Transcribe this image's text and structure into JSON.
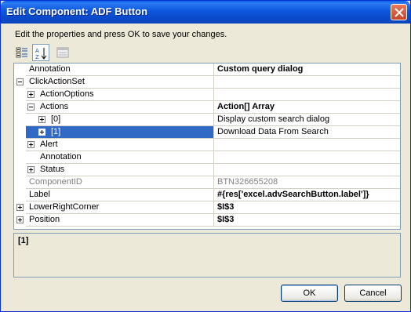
{
  "window": {
    "title": "Edit Component: ADF Button"
  },
  "instruction": "Edit the properties and press OK to save your changes.",
  "toolbar": {
    "buttons": [
      {
        "name": "categorized-view-icon",
        "active": false
      },
      {
        "name": "alphabetical-sort-icon",
        "active": true
      },
      {
        "name": "property-pages-icon",
        "active": false
      }
    ]
  },
  "grid": {
    "rows": [
      {
        "name": "Annotation",
        "value": "Custom query dialog",
        "value_bold": true,
        "indent": 0,
        "expander": "none"
      },
      {
        "name": "ClickActionSet",
        "value": "",
        "indent": 0,
        "expander": "minus"
      },
      {
        "name": "ActionOptions",
        "value": "",
        "indent": 1,
        "expander": "plus"
      },
      {
        "name": "Actions",
        "value": "Action[] Array",
        "value_bold": true,
        "indent": 1,
        "expander": "minus"
      },
      {
        "name": "[0]",
        "value": "Display custom search dialog",
        "indent": 2,
        "expander": "plus"
      },
      {
        "name": "[1]",
        "value": "Download Data From Search",
        "indent": 2,
        "expander": "plus",
        "selected": true
      },
      {
        "name": "Alert",
        "value": "",
        "indent": 1,
        "expander": "plus"
      },
      {
        "name": "Annotation",
        "value": "",
        "indent": 1,
        "expander": "none"
      },
      {
        "name": "Status",
        "value": "",
        "indent": 1,
        "expander": "plus"
      },
      {
        "name": "ComponentID",
        "value": "BTN326655208",
        "indent": 0,
        "expander": "none",
        "gray": true
      },
      {
        "name": "Label",
        "value": "#{res['excel.advSearchButton.label']}",
        "value_bold": true,
        "indent": 0,
        "expander": "none"
      },
      {
        "name": "LowerRightCorner",
        "value": "$I$3",
        "value_bold": true,
        "indent": 0,
        "expander": "plus"
      },
      {
        "name": "Position",
        "value": "$I$3",
        "value_bold": true,
        "indent": 0,
        "expander": "plus"
      }
    ]
  },
  "description": {
    "title": "[1]"
  },
  "buttons": {
    "ok_label": "OK",
    "cancel_label": "Cancel"
  },
  "colors": {
    "selection": "#316AC5",
    "titlebar": "#0A49C9"
  }
}
